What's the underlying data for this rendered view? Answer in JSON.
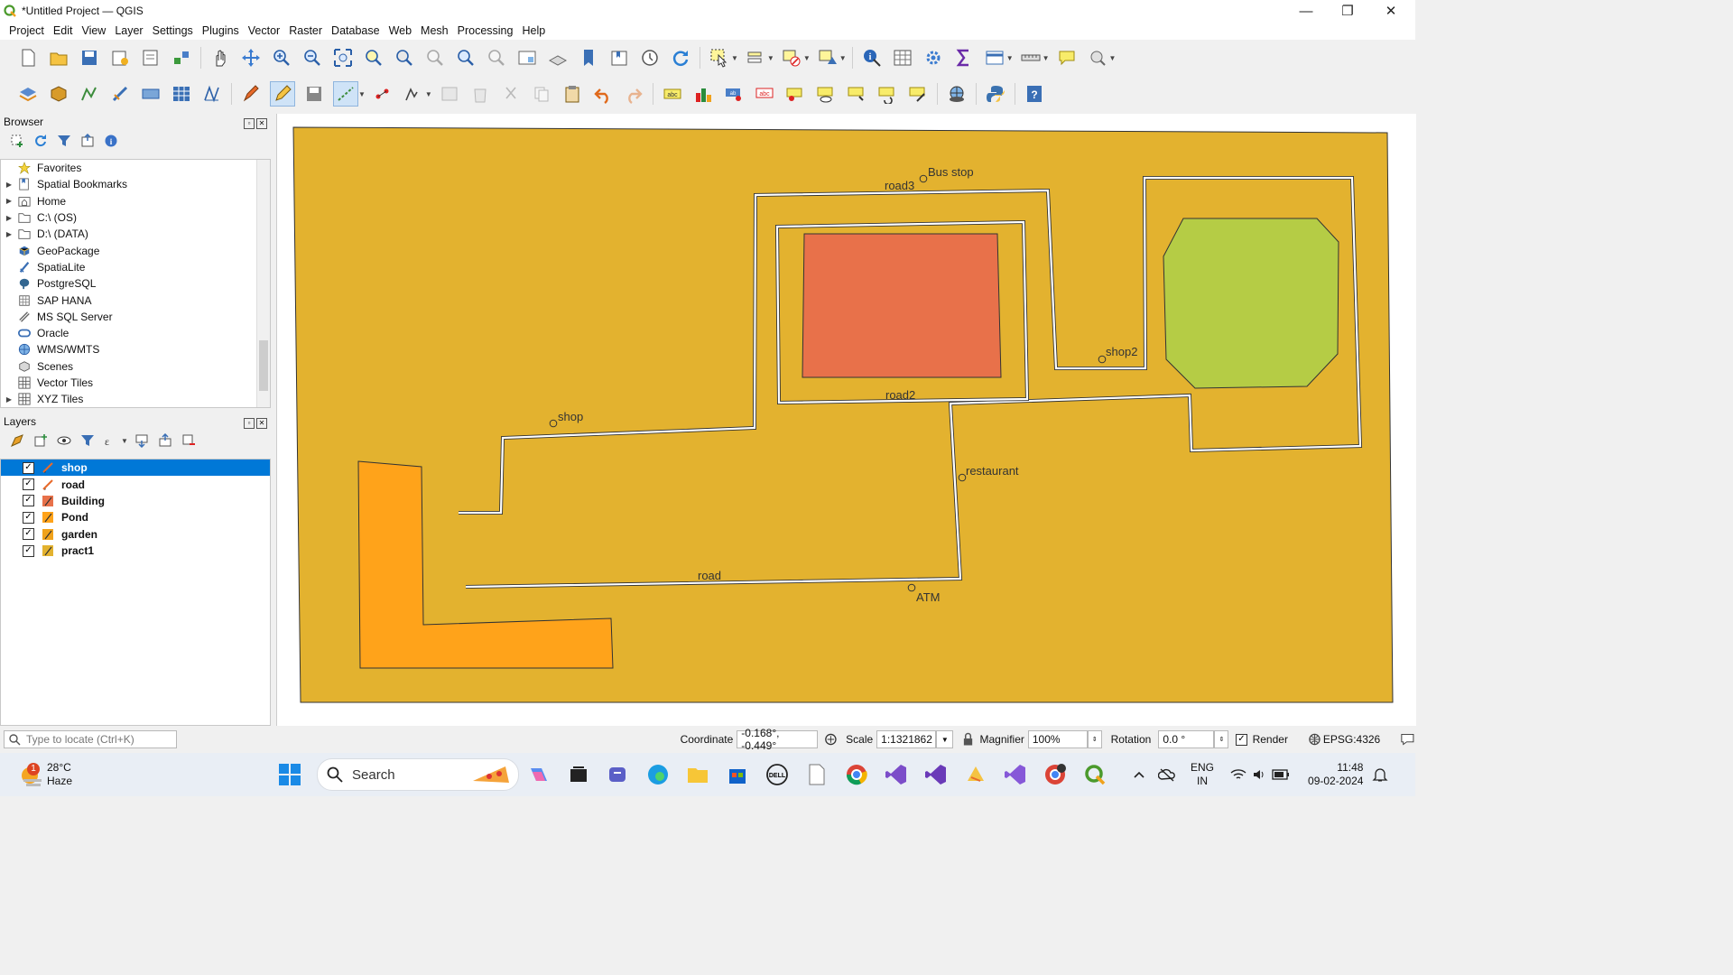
{
  "window": {
    "title": "*Untitled Project — QGIS",
    "minimize": "—",
    "restore": "❐",
    "close": "✕"
  },
  "menu": [
    "Project",
    "Edit",
    "View",
    "Layer",
    "Settings",
    "Plugins",
    "Vector",
    "Raster",
    "Database",
    "Web",
    "Mesh",
    "Processing",
    "Help"
  ],
  "browser": {
    "title": "Browser",
    "items": [
      {
        "label": "Favorites",
        "icon": "star-icon",
        "expandable": false
      },
      {
        "label": "Spatial Bookmarks",
        "icon": "bookmark-icon",
        "expandable": true
      },
      {
        "label": "Home",
        "icon": "home-folder-icon",
        "expandable": true
      },
      {
        "label": "C:\\ (OS)",
        "icon": "drive-icon",
        "expandable": true
      },
      {
        "label": "D:\\ (DATA)",
        "icon": "drive-icon",
        "expandable": true
      },
      {
        "label": "GeoPackage",
        "icon": "geopackage-icon",
        "expandable": false
      },
      {
        "label": "SpatiaLite",
        "icon": "spatialite-icon",
        "expandable": false
      },
      {
        "label": "PostgreSQL",
        "icon": "postgresql-icon",
        "expandable": false
      },
      {
        "label": "SAP HANA",
        "icon": "hana-icon",
        "expandable": false
      },
      {
        "label": "MS SQL Server",
        "icon": "mssql-icon",
        "expandable": false
      },
      {
        "label": "Oracle",
        "icon": "oracle-icon",
        "expandable": false
      },
      {
        "label": "WMS/WMTS",
        "icon": "globe-icon",
        "expandable": false
      },
      {
        "label": "Scenes",
        "icon": "scene-icon",
        "expandable": false
      },
      {
        "label": "Vector Tiles",
        "icon": "grid-icon",
        "expandable": false
      },
      {
        "label": "XYZ Tiles",
        "icon": "grid-icon",
        "expandable": true
      }
    ]
  },
  "layers": {
    "title": "Layers",
    "items": [
      {
        "name": "shop",
        "checked": true,
        "selected": true,
        "icon": "line-edit-icon"
      },
      {
        "name": "road",
        "checked": true,
        "selected": false,
        "icon": "line-edit-icon"
      },
      {
        "name": "Building",
        "checked": true,
        "selected": false,
        "icon": "polygon-edit-icon"
      },
      {
        "name": "Pond",
        "checked": true,
        "selected": false,
        "icon": "polygon-edit-icon"
      },
      {
        "name": "garden",
        "checked": true,
        "selected": false,
        "icon": "polygon-edit-icon"
      },
      {
        "name": "pract1",
        "checked": true,
        "selected": false,
        "icon": "polygon-edit-icon"
      }
    ]
  },
  "map": {
    "labels": {
      "bus_stop": "Bus stop",
      "road3": "road3",
      "road2": "road2",
      "shop2": "shop2",
      "shop": "shop",
      "restaurant": "restaurant",
      "road": "road",
      "atm": "ATM"
    },
    "colors": {
      "background": "#e3b22f",
      "building": "#e8714a",
      "garden": "#b5cc45",
      "pond": "#ffa31a",
      "road": "#ffffff",
      "outline": "#333333"
    }
  },
  "status": {
    "locate_placeholder": "Type to locate (Ctrl+K)",
    "coordinate_label": "Coordinate",
    "coordinate_value": "-0.168°, -0.449°",
    "scale_label": "Scale",
    "scale_value": "1:1321862",
    "magnifier_label": "Magnifier",
    "magnifier_value": "100%",
    "rotation_label": "Rotation",
    "rotation_value": "0.0 °",
    "render_label": "Render",
    "crs": "EPSG:4326"
  },
  "taskbar": {
    "weather_temp": "28°C",
    "weather_desc": "Haze",
    "weather_badge": "1",
    "search_label": "Search",
    "lang_top": "ENG",
    "lang_bottom": "IN",
    "time": "11:48",
    "date": "09-02-2024"
  }
}
